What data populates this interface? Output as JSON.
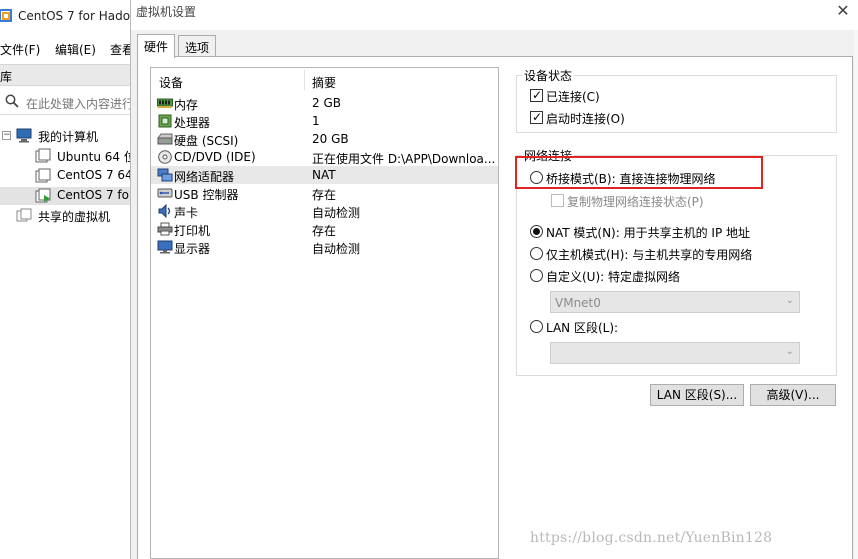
{
  "bg_window": {
    "title": "CentOS 7 for Hado",
    "menu": [
      "文件(F)",
      "编辑(E)",
      "查看"
    ],
    "library_label": "库",
    "search_placeholder": "在此处键入内容进行",
    "tree": {
      "root": "我的计算机",
      "vms": [
        "Ubuntu 64 位",
        "CentOS 7 64",
        "CentOS 7 fo"
      ],
      "shared": "共享的虚拟机"
    }
  },
  "dialog": {
    "title": "虚拟机设置",
    "tabs": [
      "硬件",
      "选项"
    ],
    "device_header": {
      "device": "设备",
      "summary": "摘要"
    },
    "devices": [
      {
        "name": "内存",
        "summary": "2 GB",
        "icon": "memory-icon"
      },
      {
        "name": "处理器",
        "summary": "1",
        "icon": "processor-icon"
      },
      {
        "name": "硬盘 (SCSI)",
        "summary": "20 GB",
        "icon": "hard-disk-icon"
      },
      {
        "name": "CD/DVD (IDE)",
        "summary": "正在使用文件 D:\\APP\\Downloa...",
        "icon": "cd-dvd-icon"
      },
      {
        "name": "网络适配器",
        "summary": "NAT",
        "icon": "network-adapter-icon"
      },
      {
        "name": "USB 控制器",
        "summary": "存在",
        "icon": "usb-icon"
      },
      {
        "name": "声卡",
        "summary": "自动检测",
        "icon": "sound-card-icon"
      },
      {
        "name": "打印机",
        "summary": "存在",
        "icon": "printer-icon"
      },
      {
        "name": "显示器",
        "summary": "自动检测",
        "icon": "display-icon"
      }
    ],
    "selected_device": "网络适配器",
    "device_status": {
      "legend": "设备状态",
      "connected": {
        "label": "已连接(C)",
        "checked": true
      },
      "connect_at_power_on": {
        "label": "启动时连接(O)",
        "checked": true
      }
    },
    "network": {
      "legend": "网络连接",
      "bridged": {
        "label": "桥接模式(B): 直接连接物理网络",
        "selected": false
      },
      "replicate": {
        "label": "复制物理网络连接状态(P)",
        "checked": false,
        "enabled": false
      },
      "nat": {
        "label": "NAT 模式(N): 用于共享主机的 IP 地址",
        "selected": true
      },
      "host_only": {
        "label": "仅主机模式(H): 与主机共享的专用网络",
        "selected": false
      },
      "custom": {
        "label": "自定义(U): 特定虚拟网络",
        "selected": false
      },
      "custom_value": "VMnet0",
      "lan": {
        "label": "LAN 区段(L):",
        "selected": false
      },
      "lan_value": ""
    },
    "buttons": {
      "lan_segments": "LAN 区段(S)...",
      "advanced": "高级(V)..."
    },
    "close_glyph": "✕"
  },
  "watermark": "https://blog.csdn.net/YuenBin128",
  "colors": {
    "highlight_box": "#e02323",
    "selected_row": "#e8e8e8"
  }
}
